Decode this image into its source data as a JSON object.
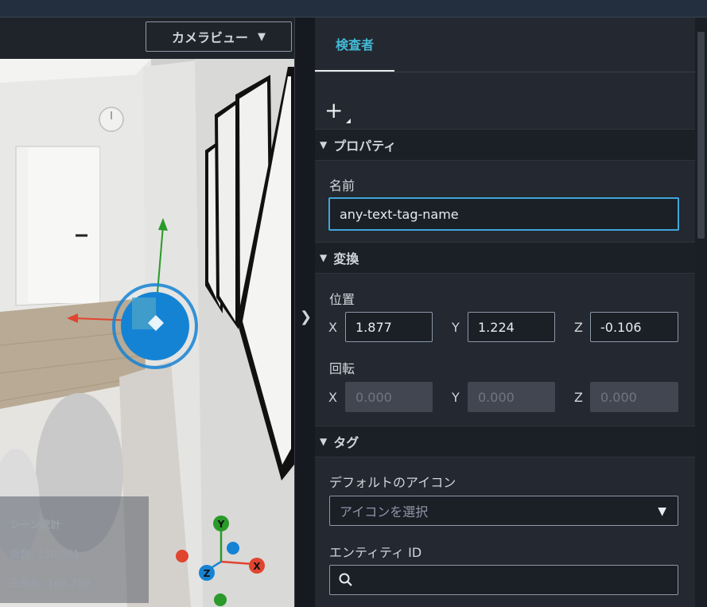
{
  "viewport": {
    "camera_view_label": "カメラビュー",
    "stats": {
      "title": "シーン統計",
      "line1": "面数: 130,081",
      "line2": "三角形: 160,780"
    },
    "gizmo_axes": {
      "y": "Y",
      "x": "X",
      "z": "Z"
    }
  },
  "inspector": {
    "tab_label": "検査者",
    "add_label": "+",
    "sections": {
      "properties": "プロパティ",
      "transform": "変換",
      "tags": "タグ"
    },
    "name_label": "名前",
    "name_value": "any-text-tag-name",
    "position_label": "位置",
    "position": {
      "x": "1.877",
      "y": "1.224",
      "z": "-0.106"
    },
    "rotation_label": "回転",
    "rotation": {
      "x": "0.000",
      "y": "0.000",
      "z": "0.000"
    },
    "axis_labels": {
      "x": "X",
      "y": "Y",
      "z": "Z"
    },
    "default_icon_label": "デフォルトのアイコン",
    "icon_select_placeholder": "アイコンを選択",
    "entity_id_label": "エンティティ ID",
    "entity_id_value": ""
  },
  "colors": {
    "accent": "#44b9d6",
    "gizmo_blue": "#1583d4",
    "axis_x": "#e0452f",
    "axis_y": "#2a9a2a",
    "axis_z": "#1583d4"
  }
}
